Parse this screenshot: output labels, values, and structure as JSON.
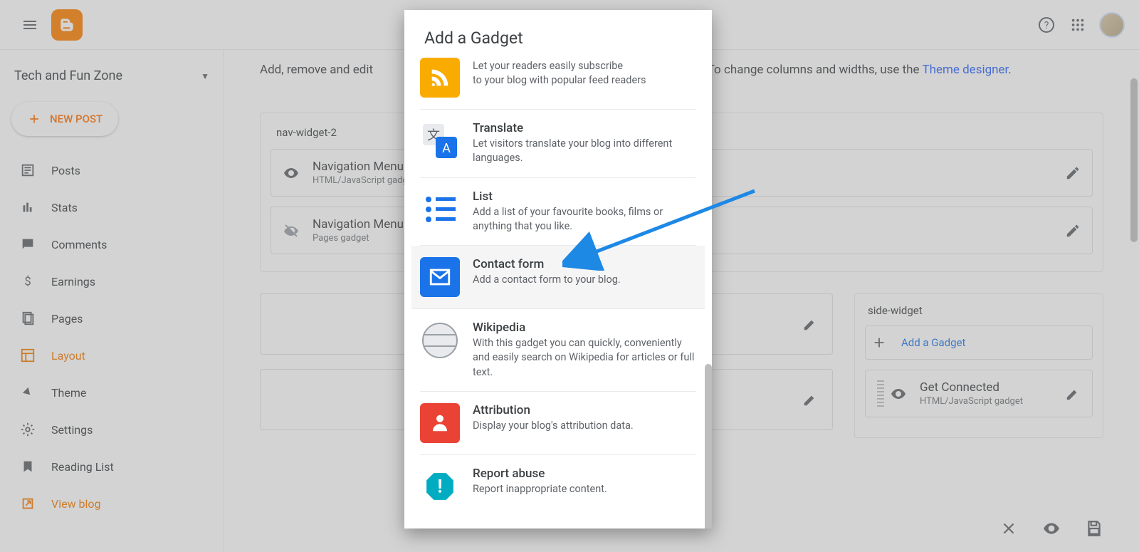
{
  "header": {
    "blog_name": "Tech and Fun Zone"
  },
  "sidebar": {
    "new_post": "NEW POST",
    "items": [
      {
        "label": "Posts"
      },
      {
        "label": "Stats"
      },
      {
        "label": "Comments"
      },
      {
        "label": "Earnings"
      },
      {
        "label": "Pages"
      },
      {
        "label": "Layout"
      },
      {
        "label": "Theme"
      },
      {
        "label": "Settings"
      },
      {
        "label": "Reading List"
      },
      {
        "label": "View blog"
      }
    ]
  },
  "main": {
    "helper_prefix": "Add, remove and edit",
    "helper_mid": "gets. To change columns and widths, use the ",
    "helper_link": "Theme designer",
    "helper_period": ".",
    "section1_title": "nav-widget-2",
    "widget1": {
      "title": "Navigation Menu",
      "sub": "HTML/JavaScript gadget"
    },
    "widget2": {
      "title": "Navigation Menu (Simple)",
      "sub": "Pages gadget"
    },
    "side_title": "side-widget",
    "add_gadget": "Add a Gadget",
    "side_card": {
      "title": "Get Connected",
      "sub": "HTML/JavaScript gadget"
    }
  },
  "modal": {
    "title": "Add a Gadget",
    "gadgets": [
      {
        "title": "",
        "desc": "to your blog with popular feed readers",
        "desc2": "",
        "partial_top": "Let your readers easily subscribe"
      },
      {
        "title": "Translate",
        "desc": "Let visitors translate your blog into different languages."
      },
      {
        "title": "List",
        "desc": "Add a list of your favourite books, films or anything that you like."
      },
      {
        "title": "Contact form",
        "desc": "Add a contact form to your blog."
      },
      {
        "title": "Wikipedia",
        "desc": "With this gadget you can quickly, conveniently and easily search on Wikipedia for articles or full text."
      },
      {
        "title": "Attribution",
        "desc": "Display your blog's attribution data."
      },
      {
        "title": "Report abuse",
        "desc": "Report inappropriate content."
      }
    ]
  }
}
